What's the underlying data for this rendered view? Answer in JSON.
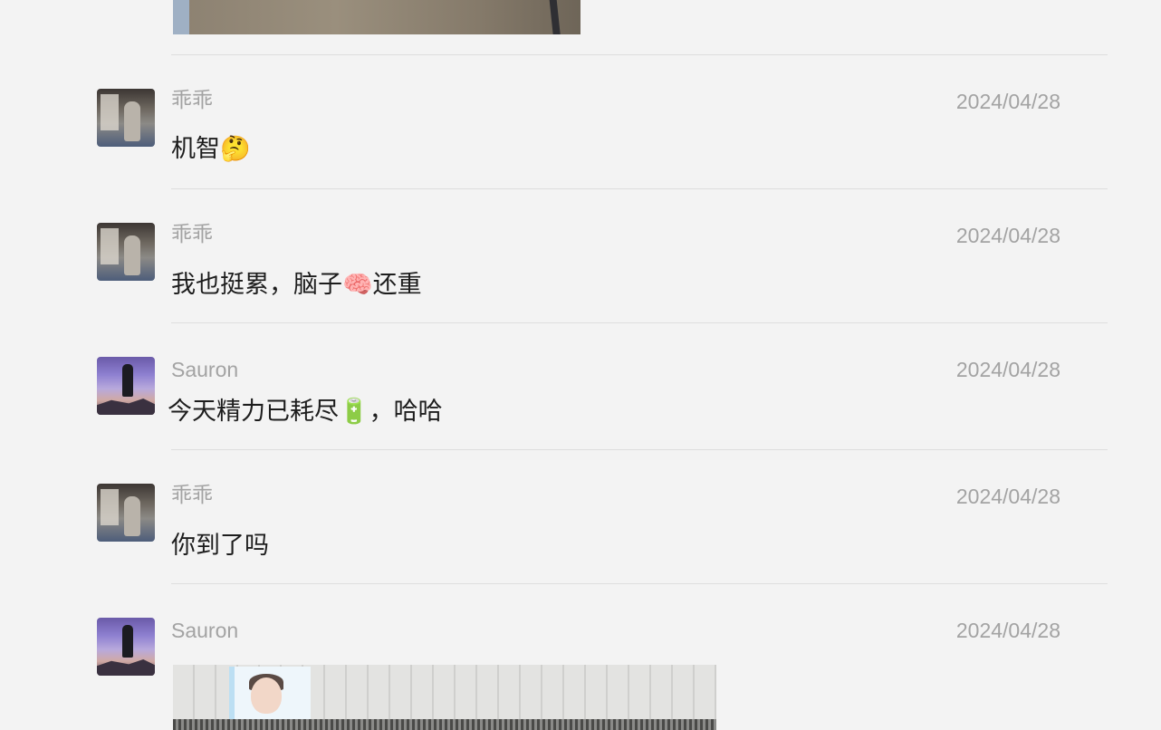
{
  "messages": [
    {
      "sender": "乖乖",
      "date": "2024/04/28",
      "text": "机智🤔"
    },
    {
      "sender": "乖乖",
      "date": "2024/04/28",
      "text": "我也挺累，脑子🧠还重"
    },
    {
      "sender": "Sauron",
      "date": "2024/04/28",
      "text": "今天精力已耗尽🔋，哈哈"
    },
    {
      "sender": "乖乖",
      "date": "2024/04/28",
      "text": "你到了吗"
    },
    {
      "sender": "Sauron",
      "date": "2024/04/28",
      "text": ""
    }
  ],
  "images": {
    "top": "photo-attachment",
    "bottom": "photo-attachment"
  },
  "avatars": {
    "guaiguai": "avatar-guaiguai",
    "sauron": "avatar-sauron"
  }
}
